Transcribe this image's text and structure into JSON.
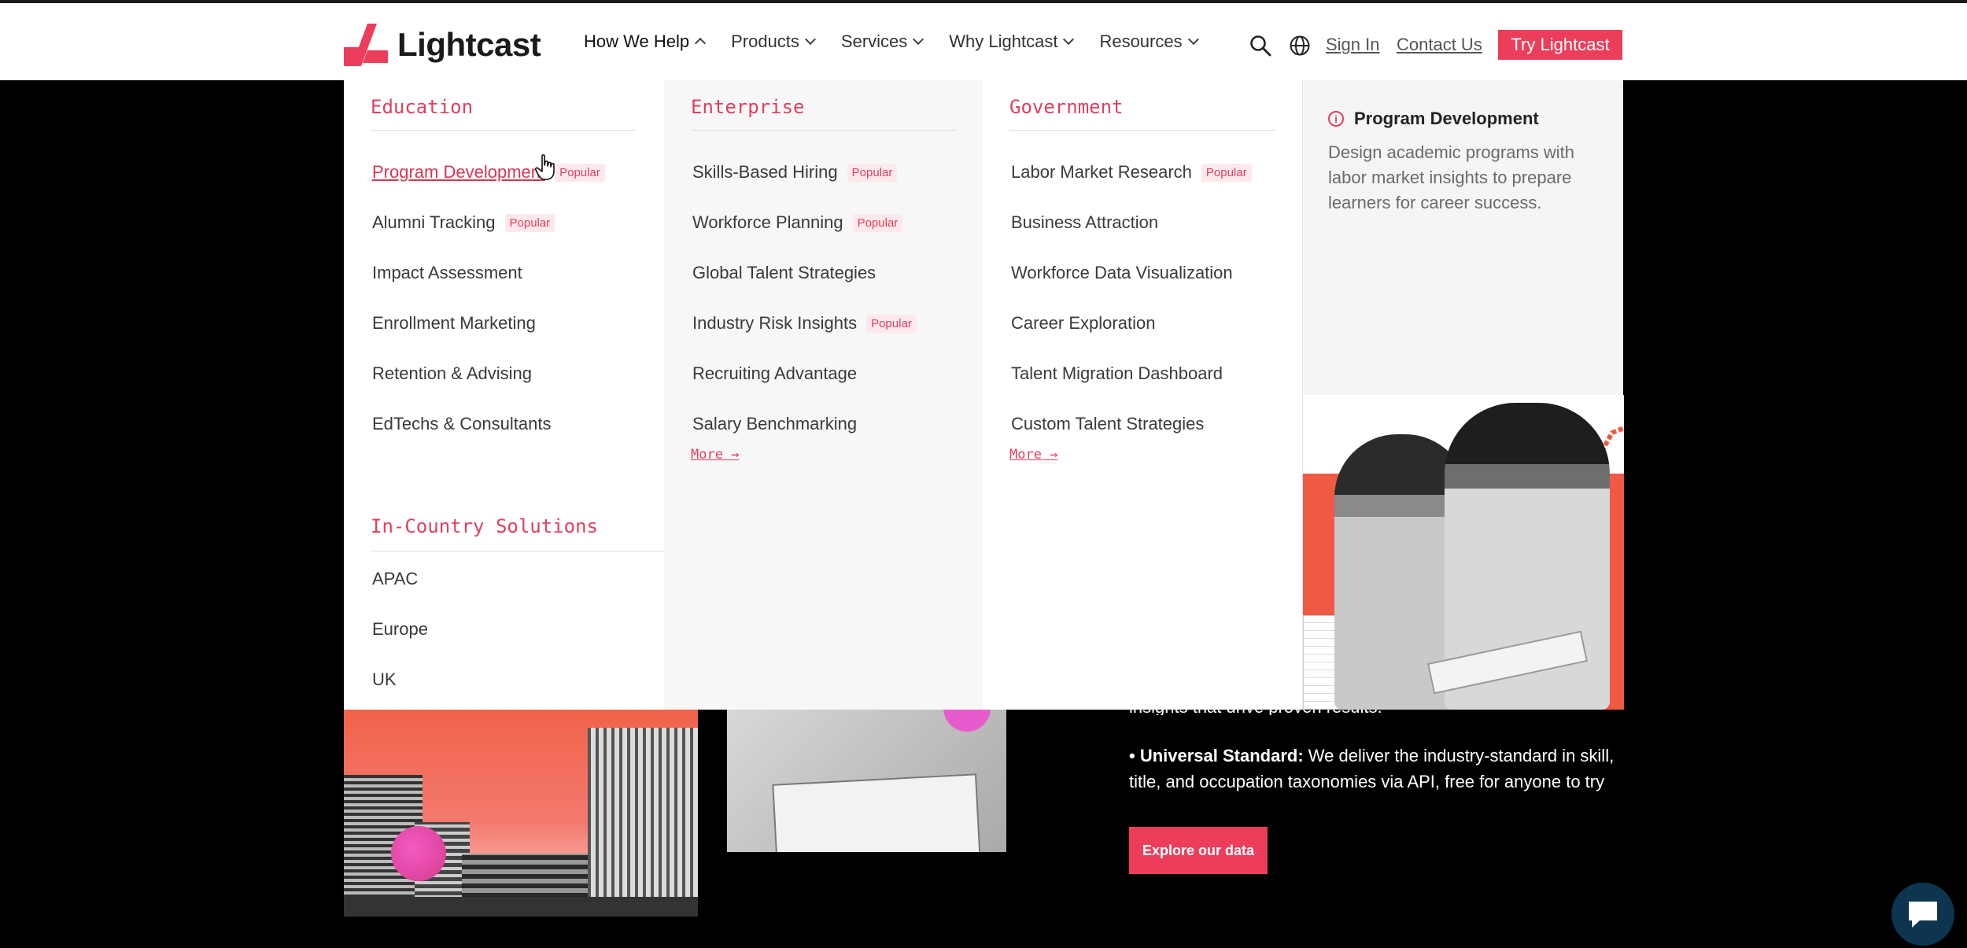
{
  "header": {
    "logo_text": "Lightcast",
    "nav": [
      {
        "label": "How We Help",
        "active": true
      },
      {
        "label": "Products",
        "active": false
      },
      {
        "label": "Services",
        "active": false
      },
      {
        "label": "Why Lightcast",
        "active": false
      },
      {
        "label": "Resources",
        "active": false
      }
    ],
    "sign_in": "Sign In",
    "contact": "Contact Us",
    "try_button": "Try Lightcast"
  },
  "menu": {
    "popular_badge": "Popular",
    "education": {
      "title": "Education",
      "items": [
        "Program Development",
        "Alumni Tracking",
        "Impact Assessment",
        "Enrollment Marketing",
        "Retention & Advising",
        "EdTechs & Consultants"
      ]
    },
    "enterprise": {
      "title": "Enterprise",
      "items": [
        "Skills-Based Hiring",
        "Workforce Planning",
        "Global Talent Strategies",
        "Industry Risk Insights",
        "Recruiting Advantage",
        "Salary Benchmarking"
      ],
      "more": "More →"
    },
    "government": {
      "title": "Government",
      "items": [
        "Labor Market Research",
        "Business Attraction",
        "Workforce Data Visualization",
        "Career Exploration",
        "Talent Migration Dashboard",
        "Custom Talent Strategies"
      ],
      "more": "More →"
    },
    "in_country": {
      "title": "In-Country Solutions",
      "items": [
        "APAC",
        "Europe",
        "UK"
      ]
    },
    "preview": {
      "title": "Program Development",
      "description": "Design academic programs with labor market insights to prepare learners for career success."
    }
  },
  "page": {
    "partial_text": "insights that drive proven results.",
    "universal_label": "• Universal Standard:",
    "universal_text": " We deliver the industry-standard in skill, title, and occupation taxonomies via API, free for anyone to try",
    "explore_button": "Explore our data"
  },
  "colors": {
    "accent": "#ec3e5b",
    "menu_heading": "#e0405e",
    "chat": "#0d3550"
  }
}
